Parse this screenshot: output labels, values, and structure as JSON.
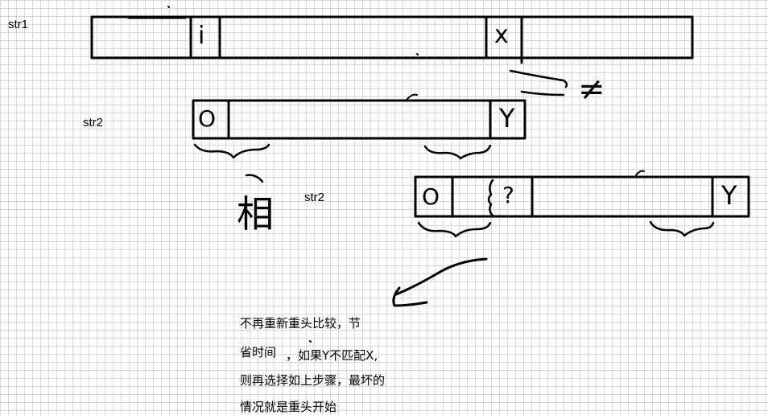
{
  "labels": {
    "str1": "str1",
    "str2_top": "str2",
    "str2_bottom": "str2"
  },
  "str1_cells": {
    "i": "i",
    "x": "x"
  },
  "str2_top_cells": {
    "first": "O",
    "last": "Y"
  },
  "str2_bottom_cells": {
    "first": "O",
    "question": "?",
    "last": "Y"
  },
  "marks": {
    "not_equal": "≠",
    "xiang": "相"
  },
  "note": {
    "line1": "不再重新重头比较，节",
    "line2": "省时间",
    "line2b": "，如果Y不匹配X,",
    "line3": "则再选择如上步骤，最坏的",
    "line4": "情况就是重头开始"
  }
}
